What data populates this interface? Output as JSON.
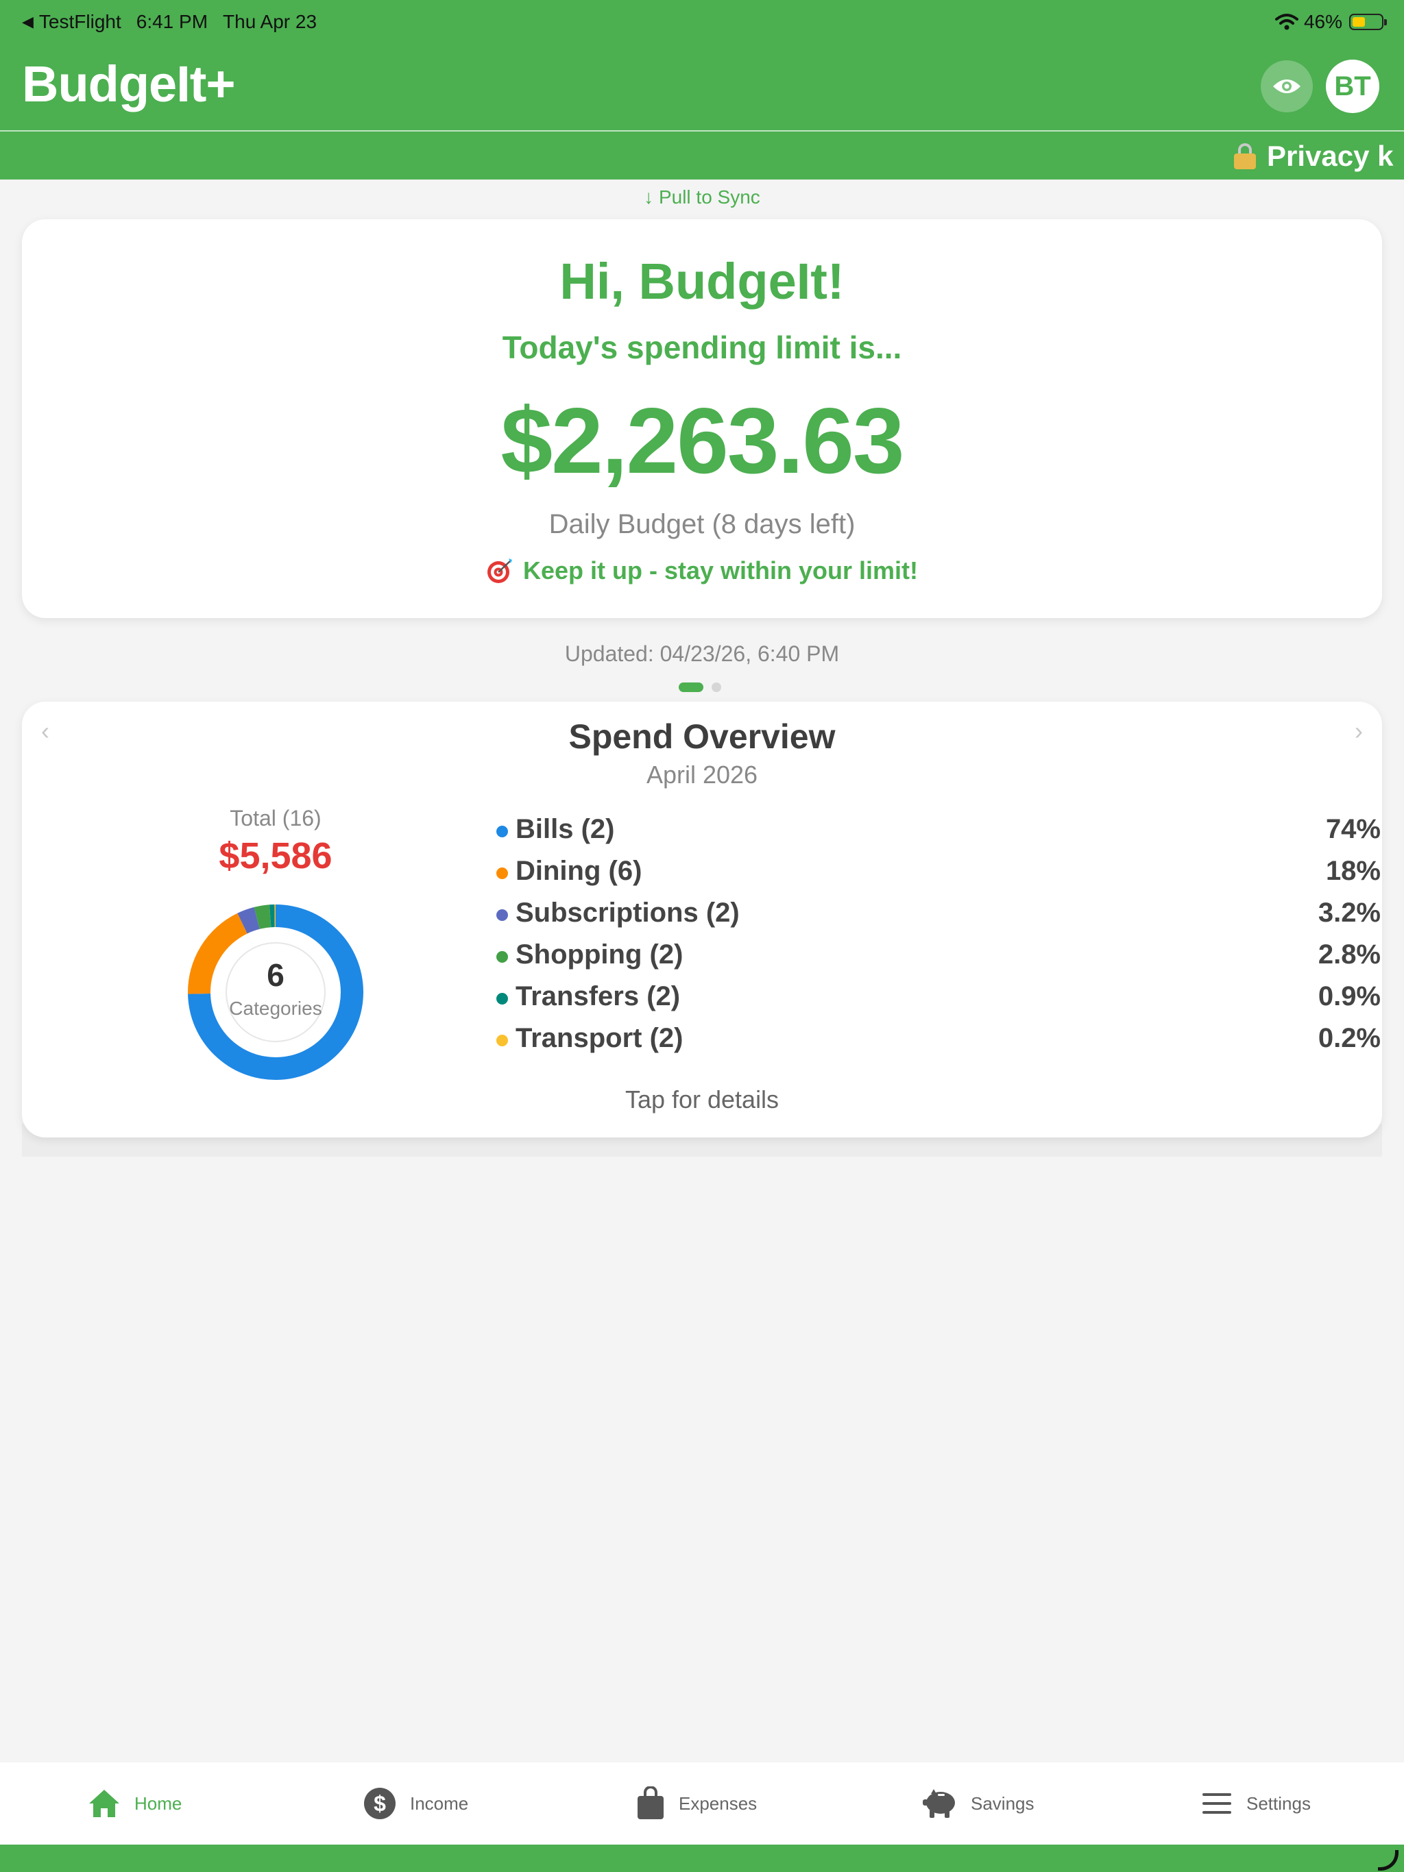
{
  "status_bar": {
    "back_app": "TestFlight",
    "time": "6:41 PM",
    "date": "Thu Apr 23",
    "battery": "46%"
  },
  "header": {
    "title": "BudgeIt+",
    "avatar_initials": "BT",
    "privacy_banner": "Privacy k"
  },
  "pull_to_sync": "↓ Pull to Sync",
  "budget_card": {
    "greeting": "Hi, BudgeIt!",
    "subtitle": "Today's spending limit is...",
    "amount": "$2,263.63",
    "daily_label": "Daily Budget (8 days left)",
    "encouragement": "Keep it up - stay within your limit!"
  },
  "updated": "Updated: 04/23/26, 6:40 PM",
  "spend_overview": {
    "title": "Spend Overview",
    "month": "April 2026",
    "total_label": "Total (16)",
    "total_amount": "$5,586",
    "center_count": "6",
    "center_label": "Categories",
    "tap_hint": "Tap for details",
    "categories": [
      {
        "label": "Bills (2)",
        "pct": "74%",
        "value": 74,
        "color": "#1e88e5"
      },
      {
        "label": "Dining (6)",
        "pct": "18%",
        "value": 18,
        "color": "#fb8c00"
      },
      {
        "label": "Subscriptions (2)",
        "pct": "3.2%",
        "value": 3.2,
        "color": "#5c6bc0"
      },
      {
        "label": "Shopping (2)",
        "pct": "2.8%",
        "value": 2.8,
        "color": "#43a047"
      },
      {
        "label": "Transfers (2)",
        "pct": "0.9%",
        "value": 0.9,
        "color": "#00897b"
      },
      {
        "label": "Transport (2)",
        "pct": "0.2%",
        "value": 0.2,
        "color": "#fbc02d"
      }
    ]
  },
  "tabs": [
    {
      "label": "Home",
      "icon": "home-icon",
      "active": true
    },
    {
      "label": "Income",
      "icon": "dollar-icon",
      "active": false
    },
    {
      "label": "Expenses",
      "icon": "shopping-bag-icon",
      "active": false
    },
    {
      "label": "Savings",
      "icon": "piggy-bank-icon",
      "active": false
    },
    {
      "label": "Settings",
      "icon": "menu-icon",
      "active": false
    }
  ],
  "colors": {
    "brand_green": "#4caf50",
    "total_red": "#e53935"
  }
}
